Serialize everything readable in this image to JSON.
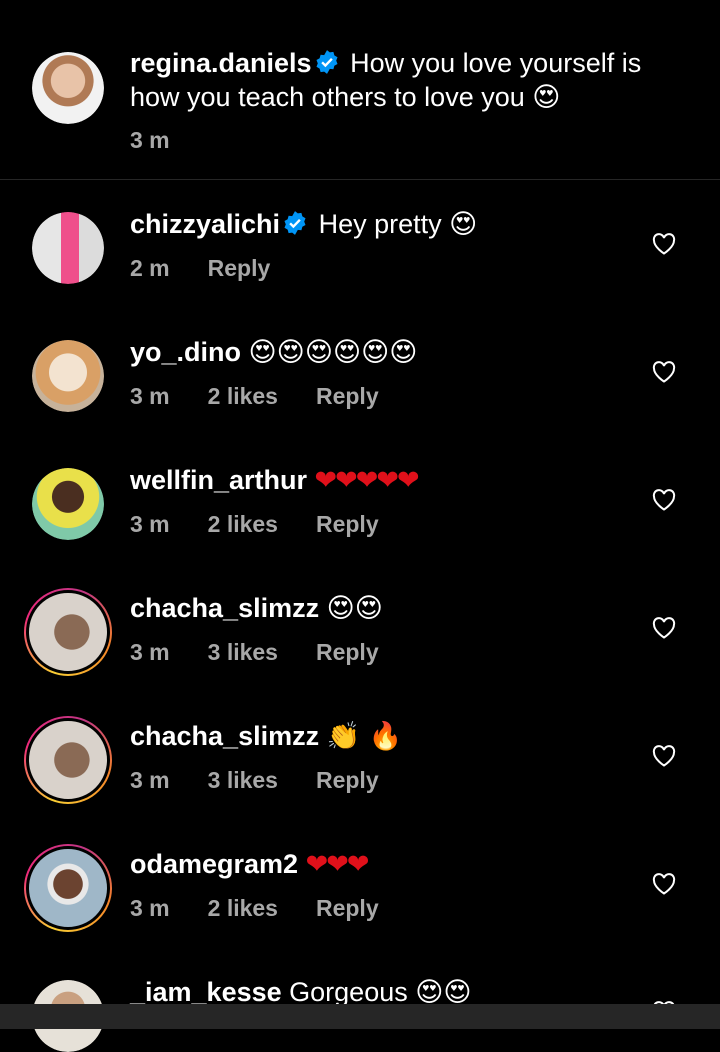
{
  "caption": {
    "username": "regina.daniels",
    "text_line1": "How you love yourself is",
    "text_line2": "how you teach others to love you",
    "emoji": "😍",
    "time": "3 m"
  },
  "comments": [
    {
      "username": "chizzyalichi",
      "text": "Hey pretty",
      "emoji": "😍",
      "time": "2 m",
      "likes": "",
      "reply": "Reply",
      "verified": true
    },
    {
      "username": "yo_.dino",
      "text": "",
      "emoji": "😍😍😍😍😍😍",
      "time": "3 m",
      "likes": "2 likes",
      "reply": "Reply"
    },
    {
      "username": "wellfin_arthur",
      "text": "",
      "emoji": "❤❤❤❤❤",
      "time": "3 m",
      "likes": "2 likes",
      "reply": "Reply"
    },
    {
      "username": "chacha_slimzz",
      "text": "",
      "emoji": "😍😍",
      "time": "3 m",
      "likes": "3 likes",
      "reply": "Reply"
    },
    {
      "username": "chacha_slimzz",
      "text": "",
      "emoji": "👏 🔥",
      "time": "3 m",
      "likes": "3 likes",
      "reply": "Reply"
    },
    {
      "username": "odamegram2",
      "text": "",
      "emoji": "❤❤❤",
      "time": "3 m",
      "likes": "2 likes",
      "reply": "Reply"
    },
    {
      "username": "_iam_kesse",
      "text": "Gorgeous",
      "emoji": "😍😍",
      "time": "",
      "likes": "",
      "reply": ""
    }
  ],
  "colors": {
    "background": "#000000",
    "meta_text": "#a8a8a8",
    "verified": "#0095f6",
    "heart_emoji": "#e0101a"
  },
  "icons": {
    "like": "heart-outline-icon",
    "verified": "verified-badge-icon"
  }
}
